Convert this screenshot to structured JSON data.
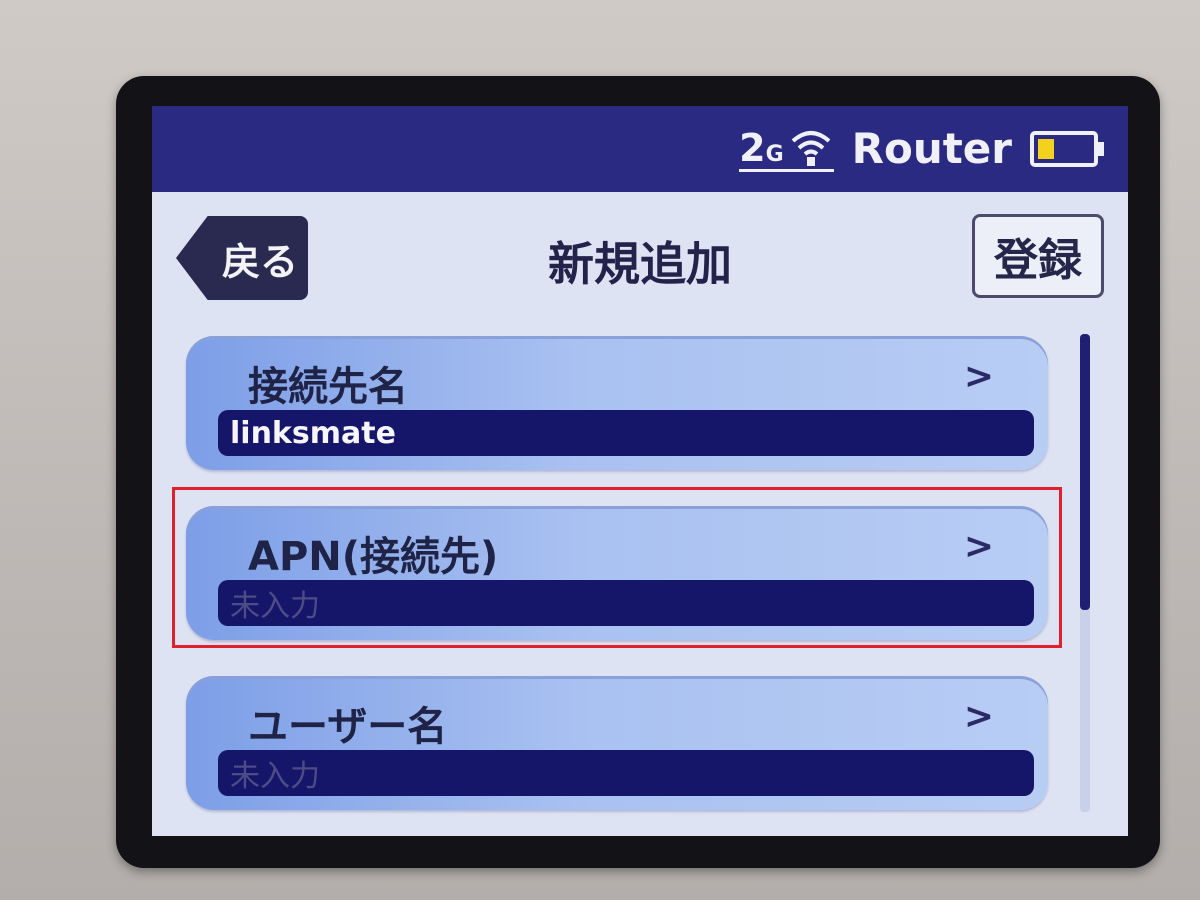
{
  "status_bar": {
    "network_type": "2",
    "network_suffix": "G",
    "mode": "Router",
    "icons": [
      "wifi-icon",
      "battery-icon"
    ],
    "battery_level": 0.25
  },
  "header": {
    "back_label": "戻る",
    "title": "新規追加",
    "register_label": "登録"
  },
  "items": [
    {
      "label": "接続先名",
      "value": "linksmate",
      "chevron": ">"
    },
    {
      "label": "APN(接続先)",
      "value": "未入力",
      "chevron": ">"
    },
    {
      "label": "ユーザー名",
      "value": "未入力",
      "chevron": ">"
    }
  ],
  "colors": {
    "status_bar": "#2a2a82",
    "field_background": "#15156a",
    "highlight": "#e0202a"
  }
}
